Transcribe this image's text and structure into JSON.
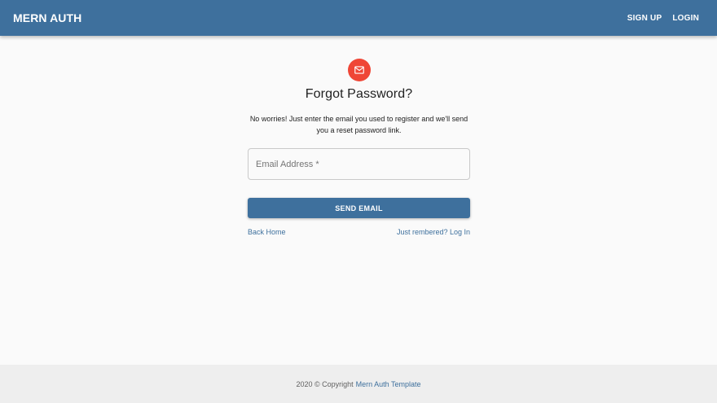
{
  "header": {
    "brand": "MERN AUTH",
    "nav": {
      "signup_label": "SIGN UP",
      "login_label": "LOGIN"
    }
  },
  "form": {
    "icon": "mail-icon",
    "title": "Forgot Password?",
    "description": "No worries! Just enter the email you used to register and we'll send you a reset password link.",
    "email": {
      "placeholder": "Email Address *",
      "value": ""
    },
    "submit_label": "SEND EMAIL",
    "back_home_label": "Back Home",
    "login_link_label": "Just rembered? Log In"
  },
  "footer": {
    "copyright": "2020 © Copyright",
    "link_label": "Mern Auth Template"
  },
  "colors": {
    "primary": "#3e709d",
    "avatar": "#ef4636",
    "background": "#fafafa",
    "footer_bg": "#eeeeee"
  }
}
